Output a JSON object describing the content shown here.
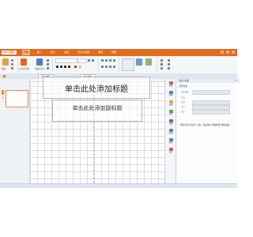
{
  "app": {
    "logo": "WPS 演示",
    "menus": [
      "开始",
      "插入",
      "设计",
      "动画",
      "幻灯片放映",
      "审阅",
      "视图"
    ],
    "active_menu": "开始"
  },
  "ribbon": {
    "paste_label": "粘贴",
    "new_slide_label": "从当前开始",
    "layout_label": "新建幻灯片",
    "groups": [
      "剪贴板",
      "幻灯片",
      "字体",
      "段落",
      "绘图"
    ]
  },
  "tabs": [
    {
      "label": "演示文稿1",
      "active": false
    },
    {
      "label": "演示文稿1",
      "active": true
    }
  ],
  "thumbnails": [
    {
      "number": "1"
    }
  ],
  "slide": {
    "title_placeholder": "单击此处添加标题",
    "subtitle_placeholder": "单击此处添加副标题"
  },
  "side_items": [
    {
      "label": "新建",
      "color": "#d9534f"
    },
    {
      "label": "切换",
      "color": "#5b7fb5"
    },
    {
      "label": "动画",
      "color": "#e8a33b"
    },
    {
      "label": "自定",
      "color": "#5b9f4a"
    },
    {
      "label": "效果",
      "color": "#7a5fb0"
    },
    {
      "label": "选择",
      "color": "#5b7fb5"
    },
    {
      "label": "属性",
      "color": "#3f8fc2"
    },
    {
      "label": "设计",
      "color": "#d9534f"
    }
  ],
  "task_pane": {
    "title": "自定义动画",
    "close": "×",
    "selected": "选择窗格",
    "fields": [
      "添加效果",
      "修改",
      "开始",
      "方向",
      "速度"
    ],
    "note": "选中幻灯片的某个元素，然后单击\"添加效果\"添加动画。"
  }
}
